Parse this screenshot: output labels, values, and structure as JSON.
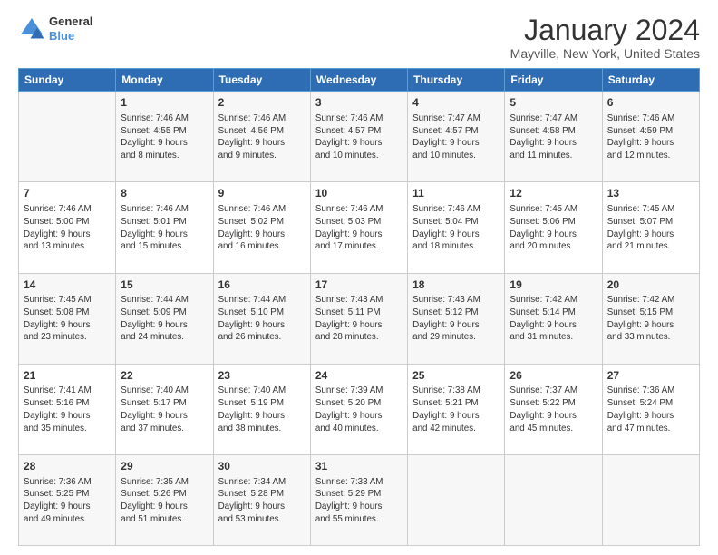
{
  "logo": {
    "line1": "General",
    "line2": "Blue",
    "icon_color": "#4a90d9"
  },
  "title": "January 2024",
  "subtitle": "Mayville, New York, United States",
  "days_of_week": [
    "Sunday",
    "Monday",
    "Tuesday",
    "Wednesday",
    "Thursday",
    "Friday",
    "Saturday"
  ],
  "weeks": [
    [
      {
        "day": "",
        "info": ""
      },
      {
        "day": "1",
        "info": "Sunrise: 7:46 AM\nSunset: 4:55 PM\nDaylight: 9 hours\nand 8 minutes."
      },
      {
        "day": "2",
        "info": "Sunrise: 7:46 AM\nSunset: 4:56 PM\nDaylight: 9 hours\nand 9 minutes."
      },
      {
        "day": "3",
        "info": "Sunrise: 7:46 AM\nSunset: 4:57 PM\nDaylight: 9 hours\nand 10 minutes."
      },
      {
        "day": "4",
        "info": "Sunrise: 7:47 AM\nSunset: 4:57 PM\nDaylight: 9 hours\nand 10 minutes."
      },
      {
        "day": "5",
        "info": "Sunrise: 7:47 AM\nSunset: 4:58 PM\nDaylight: 9 hours\nand 11 minutes."
      },
      {
        "day": "6",
        "info": "Sunrise: 7:46 AM\nSunset: 4:59 PM\nDaylight: 9 hours\nand 12 minutes."
      }
    ],
    [
      {
        "day": "7",
        "info": "Sunrise: 7:46 AM\nSunset: 5:00 PM\nDaylight: 9 hours\nand 13 minutes."
      },
      {
        "day": "8",
        "info": "Sunrise: 7:46 AM\nSunset: 5:01 PM\nDaylight: 9 hours\nand 15 minutes."
      },
      {
        "day": "9",
        "info": "Sunrise: 7:46 AM\nSunset: 5:02 PM\nDaylight: 9 hours\nand 16 minutes."
      },
      {
        "day": "10",
        "info": "Sunrise: 7:46 AM\nSunset: 5:03 PM\nDaylight: 9 hours\nand 17 minutes."
      },
      {
        "day": "11",
        "info": "Sunrise: 7:46 AM\nSunset: 5:04 PM\nDaylight: 9 hours\nand 18 minutes."
      },
      {
        "day": "12",
        "info": "Sunrise: 7:45 AM\nSunset: 5:06 PM\nDaylight: 9 hours\nand 20 minutes."
      },
      {
        "day": "13",
        "info": "Sunrise: 7:45 AM\nSunset: 5:07 PM\nDaylight: 9 hours\nand 21 minutes."
      }
    ],
    [
      {
        "day": "14",
        "info": "Sunrise: 7:45 AM\nSunset: 5:08 PM\nDaylight: 9 hours\nand 23 minutes."
      },
      {
        "day": "15",
        "info": "Sunrise: 7:44 AM\nSunset: 5:09 PM\nDaylight: 9 hours\nand 24 minutes."
      },
      {
        "day": "16",
        "info": "Sunrise: 7:44 AM\nSunset: 5:10 PM\nDaylight: 9 hours\nand 26 minutes."
      },
      {
        "day": "17",
        "info": "Sunrise: 7:43 AM\nSunset: 5:11 PM\nDaylight: 9 hours\nand 28 minutes."
      },
      {
        "day": "18",
        "info": "Sunrise: 7:43 AM\nSunset: 5:12 PM\nDaylight: 9 hours\nand 29 minutes."
      },
      {
        "day": "19",
        "info": "Sunrise: 7:42 AM\nSunset: 5:14 PM\nDaylight: 9 hours\nand 31 minutes."
      },
      {
        "day": "20",
        "info": "Sunrise: 7:42 AM\nSunset: 5:15 PM\nDaylight: 9 hours\nand 33 minutes."
      }
    ],
    [
      {
        "day": "21",
        "info": "Sunrise: 7:41 AM\nSunset: 5:16 PM\nDaylight: 9 hours\nand 35 minutes."
      },
      {
        "day": "22",
        "info": "Sunrise: 7:40 AM\nSunset: 5:17 PM\nDaylight: 9 hours\nand 37 minutes."
      },
      {
        "day": "23",
        "info": "Sunrise: 7:40 AM\nSunset: 5:19 PM\nDaylight: 9 hours\nand 38 minutes."
      },
      {
        "day": "24",
        "info": "Sunrise: 7:39 AM\nSunset: 5:20 PM\nDaylight: 9 hours\nand 40 minutes."
      },
      {
        "day": "25",
        "info": "Sunrise: 7:38 AM\nSunset: 5:21 PM\nDaylight: 9 hours\nand 42 minutes."
      },
      {
        "day": "26",
        "info": "Sunrise: 7:37 AM\nSunset: 5:22 PM\nDaylight: 9 hours\nand 45 minutes."
      },
      {
        "day": "27",
        "info": "Sunrise: 7:36 AM\nSunset: 5:24 PM\nDaylight: 9 hours\nand 47 minutes."
      }
    ],
    [
      {
        "day": "28",
        "info": "Sunrise: 7:36 AM\nSunset: 5:25 PM\nDaylight: 9 hours\nand 49 minutes."
      },
      {
        "day": "29",
        "info": "Sunrise: 7:35 AM\nSunset: 5:26 PM\nDaylight: 9 hours\nand 51 minutes."
      },
      {
        "day": "30",
        "info": "Sunrise: 7:34 AM\nSunset: 5:28 PM\nDaylight: 9 hours\nand 53 minutes."
      },
      {
        "day": "31",
        "info": "Sunrise: 7:33 AM\nSunset: 5:29 PM\nDaylight: 9 hours\nand 55 minutes."
      },
      {
        "day": "",
        "info": ""
      },
      {
        "day": "",
        "info": ""
      },
      {
        "day": "",
        "info": ""
      }
    ]
  ]
}
